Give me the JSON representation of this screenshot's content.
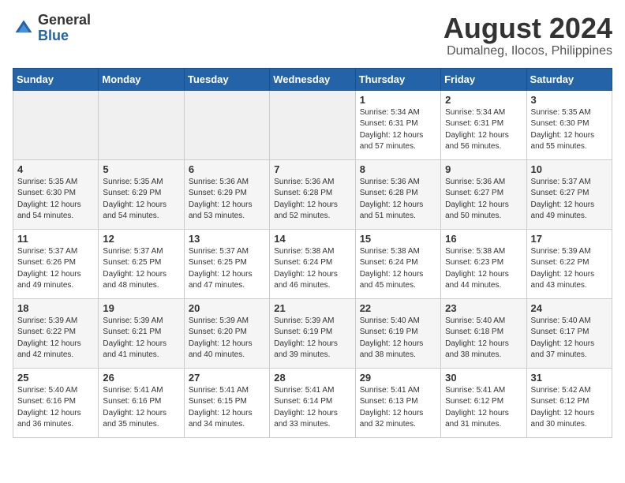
{
  "logo": {
    "general": "General",
    "blue": "Blue"
  },
  "header": {
    "month_year": "August 2024",
    "location": "Dumalneg, Ilocos, Philippines"
  },
  "weekdays": [
    "Sunday",
    "Monday",
    "Tuesday",
    "Wednesday",
    "Thursday",
    "Friday",
    "Saturday"
  ],
  "weeks": [
    {
      "days": [
        {
          "num": "",
          "info": ""
        },
        {
          "num": "",
          "info": ""
        },
        {
          "num": "",
          "info": ""
        },
        {
          "num": "",
          "info": ""
        },
        {
          "num": "1",
          "info": "Sunrise: 5:34 AM\nSunset: 6:31 PM\nDaylight: 12 hours\nand 57 minutes."
        },
        {
          "num": "2",
          "info": "Sunrise: 5:34 AM\nSunset: 6:31 PM\nDaylight: 12 hours\nand 56 minutes."
        },
        {
          "num": "3",
          "info": "Sunrise: 5:35 AM\nSunset: 6:30 PM\nDaylight: 12 hours\nand 55 minutes."
        }
      ]
    },
    {
      "days": [
        {
          "num": "4",
          "info": "Sunrise: 5:35 AM\nSunset: 6:30 PM\nDaylight: 12 hours\nand 54 minutes."
        },
        {
          "num": "5",
          "info": "Sunrise: 5:35 AM\nSunset: 6:29 PM\nDaylight: 12 hours\nand 54 minutes."
        },
        {
          "num": "6",
          "info": "Sunrise: 5:36 AM\nSunset: 6:29 PM\nDaylight: 12 hours\nand 53 minutes."
        },
        {
          "num": "7",
          "info": "Sunrise: 5:36 AM\nSunset: 6:28 PM\nDaylight: 12 hours\nand 52 minutes."
        },
        {
          "num": "8",
          "info": "Sunrise: 5:36 AM\nSunset: 6:28 PM\nDaylight: 12 hours\nand 51 minutes."
        },
        {
          "num": "9",
          "info": "Sunrise: 5:36 AM\nSunset: 6:27 PM\nDaylight: 12 hours\nand 50 minutes."
        },
        {
          "num": "10",
          "info": "Sunrise: 5:37 AM\nSunset: 6:27 PM\nDaylight: 12 hours\nand 49 minutes."
        }
      ]
    },
    {
      "days": [
        {
          "num": "11",
          "info": "Sunrise: 5:37 AM\nSunset: 6:26 PM\nDaylight: 12 hours\nand 49 minutes."
        },
        {
          "num": "12",
          "info": "Sunrise: 5:37 AM\nSunset: 6:25 PM\nDaylight: 12 hours\nand 48 minutes."
        },
        {
          "num": "13",
          "info": "Sunrise: 5:37 AM\nSunset: 6:25 PM\nDaylight: 12 hours\nand 47 minutes."
        },
        {
          "num": "14",
          "info": "Sunrise: 5:38 AM\nSunset: 6:24 PM\nDaylight: 12 hours\nand 46 minutes."
        },
        {
          "num": "15",
          "info": "Sunrise: 5:38 AM\nSunset: 6:24 PM\nDaylight: 12 hours\nand 45 minutes."
        },
        {
          "num": "16",
          "info": "Sunrise: 5:38 AM\nSunset: 6:23 PM\nDaylight: 12 hours\nand 44 minutes."
        },
        {
          "num": "17",
          "info": "Sunrise: 5:39 AM\nSunset: 6:22 PM\nDaylight: 12 hours\nand 43 minutes."
        }
      ]
    },
    {
      "days": [
        {
          "num": "18",
          "info": "Sunrise: 5:39 AM\nSunset: 6:22 PM\nDaylight: 12 hours\nand 42 minutes."
        },
        {
          "num": "19",
          "info": "Sunrise: 5:39 AM\nSunset: 6:21 PM\nDaylight: 12 hours\nand 41 minutes."
        },
        {
          "num": "20",
          "info": "Sunrise: 5:39 AM\nSunset: 6:20 PM\nDaylight: 12 hours\nand 40 minutes."
        },
        {
          "num": "21",
          "info": "Sunrise: 5:39 AM\nSunset: 6:19 PM\nDaylight: 12 hours\nand 39 minutes."
        },
        {
          "num": "22",
          "info": "Sunrise: 5:40 AM\nSunset: 6:19 PM\nDaylight: 12 hours\nand 38 minutes."
        },
        {
          "num": "23",
          "info": "Sunrise: 5:40 AM\nSunset: 6:18 PM\nDaylight: 12 hours\nand 38 minutes."
        },
        {
          "num": "24",
          "info": "Sunrise: 5:40 AM\nSunset: 6:17 PM\nDaylight: 12 hours\nand 37 minutes."
        }
      ]
    },
    {
      "days": [
        {
          "num": "25",
          "info": "Sunrise: 5:40 AM\nSunset: 6:16 PM\nDaylight: 12 hours\nand 36 minutes."
        },
        {
          "num": "26",
          "info": "Sunrise: 5:41 AM\nSunset: 6:16 PM\nDaylight: 12 hours\nand 35 minutes."
        },
        {
          "num": "27",
          "info": "Sunrise: 5:41 AM\nSunset: 6:15 PM\nDaylight: 12 hours\nand 34 minutes."
        },
        {
          "num": "28",
          "info": "Sunrise: 5:41 AM\nSunset: 6:14 PM\nDaylight: 12 hours\nand 33 minutes."
        },
        {
          "num": "29",
          "info": "Sunrise: 5:41 AM\nSunset: 6:13 PM\nDaylight: 12 hours\nand 32 minutes."
        },
        {
          "num": "30",
          "info": "Sunrise: 5:41 AM\nSunset: 6:12 PM\nDaylight: 12 hours\nand 31 minutes."
        },
        {
          "num": "31",
          "info": "Sunrise: 5:42 AM\nSunset: 6:12 PM\nDaylight: 12 hours\nand 30 minutes."
        }
      ]
    }
  ]
}
